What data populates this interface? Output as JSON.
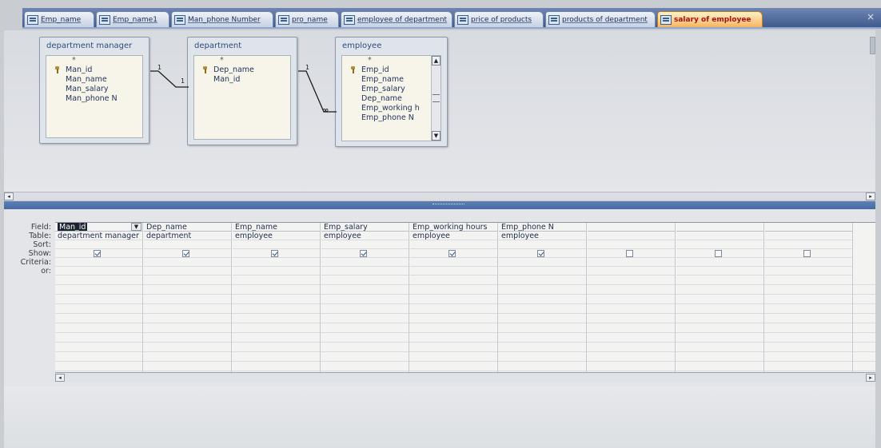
{
  "tabs": [
    {
      "label": "Emp_name",
      "active": false
    },
    {
      "label": "Emp_name1",
      "active": false
    },
    {
      "label": "Man_phone Number",
      "active": false
    },
    {
      "label": "pro_name",
      "active": false
    },
    {
      "label": "employee of department",
      "active": false
    },
    {
      "label": "price of products",
      "active": false
    },
    {
      "label": "products of department",
      "active": false
    },
    {
      "label": "salary of employee",
      "active": true
    }
  ],
  "tab_close_glyph": "×",
  "tables": [
    {
      "title": "department manager",
      "star": "*",
      "fields": [
        {
          "name": "Man_id",
          "key": true
        },
        {
          "name": "Man_name",
          "key": false
        },
        {
          "name": "Man_salary",
          "key": false
        },
        {
          "name": "Man_phone N",
          "key": false
        }
      ]
    },
    {
      "title": "department",
      "star": "*",
      "fields": [
        {
          "name": "Dep_name",
          "key": true
        },
        {
          "name": "Man_id",
          "key": false
        }
      ]
    },
    {
      "title": "employee",
      "star": "*",
      "fields": [
        {
          "name": "Emp_id",
          "key": true
        },
        {
          "name": "Emp_name",
          "key": false
        },
        {
          "name": "Emp_salary",
          "key": false
        },
        {
          "name": "Dep_name",
          "key": false
        },
        {
          "name": "Emp_working h",
          "key": false
        },
        {
          "name": "Emp_phone N",
          "key": false
        }
      ]
    }
  ],
  "relationships": [
    {
      "left": "1",
      "right": "1"
    },
    {
      "left": "1",
      "right": "∞"
    }
  ],
  "grid": {
    "row_labels": [
      "Field:",
      "Table:",
      "Sort:",
      "Show:",
      "Criteria:",
      "or:"
    ],
    "columns": [
      {
        "field": "Man_id",
        "table": "department manager",
        "show": true,
        "selected": true
      },
      {
        "field": "Dep_name",
        "table": "department",
        "show": true,
        "selected": false
      },
      {
        "field": "Emp_name",
        "table": "employee",
        "show": true,
        "selected": false
      },
      {
        "field": "Emp_salary",
        "table": "employee",
        "show": true,
        "selected": false
      },
      {
        "field": "Emp_working hours",
        "table": "employee",
        "show": true,
        "selected": false
      },
      {
        "field": "Emp_phone N",
        "table": "employee",
        "show": true,
        "selected": false
      },
      {
        "field": "",
        "table": "",
        "show": false,
        "selected": false
      },
      {
        "field": "",
        "table": "",
        "show": false,
        "selected": false
      },
      {
        "field": "",
        "table": "",
        "show": false,
        "selected": false
      }
    ]
  },
  "glyphs": {
    "left_arrow": "◂",
    "right_arrow": "▸",
    "up_arrow": "▲",
    "down_arrow": "▼",
    "dropdown": "▼"
  },
  "colors": {
    "splitter": "#4f72aa",
    "active_tab": "#f7b45f",
    "tab_strip": "#3f5a8c"
  }
}
